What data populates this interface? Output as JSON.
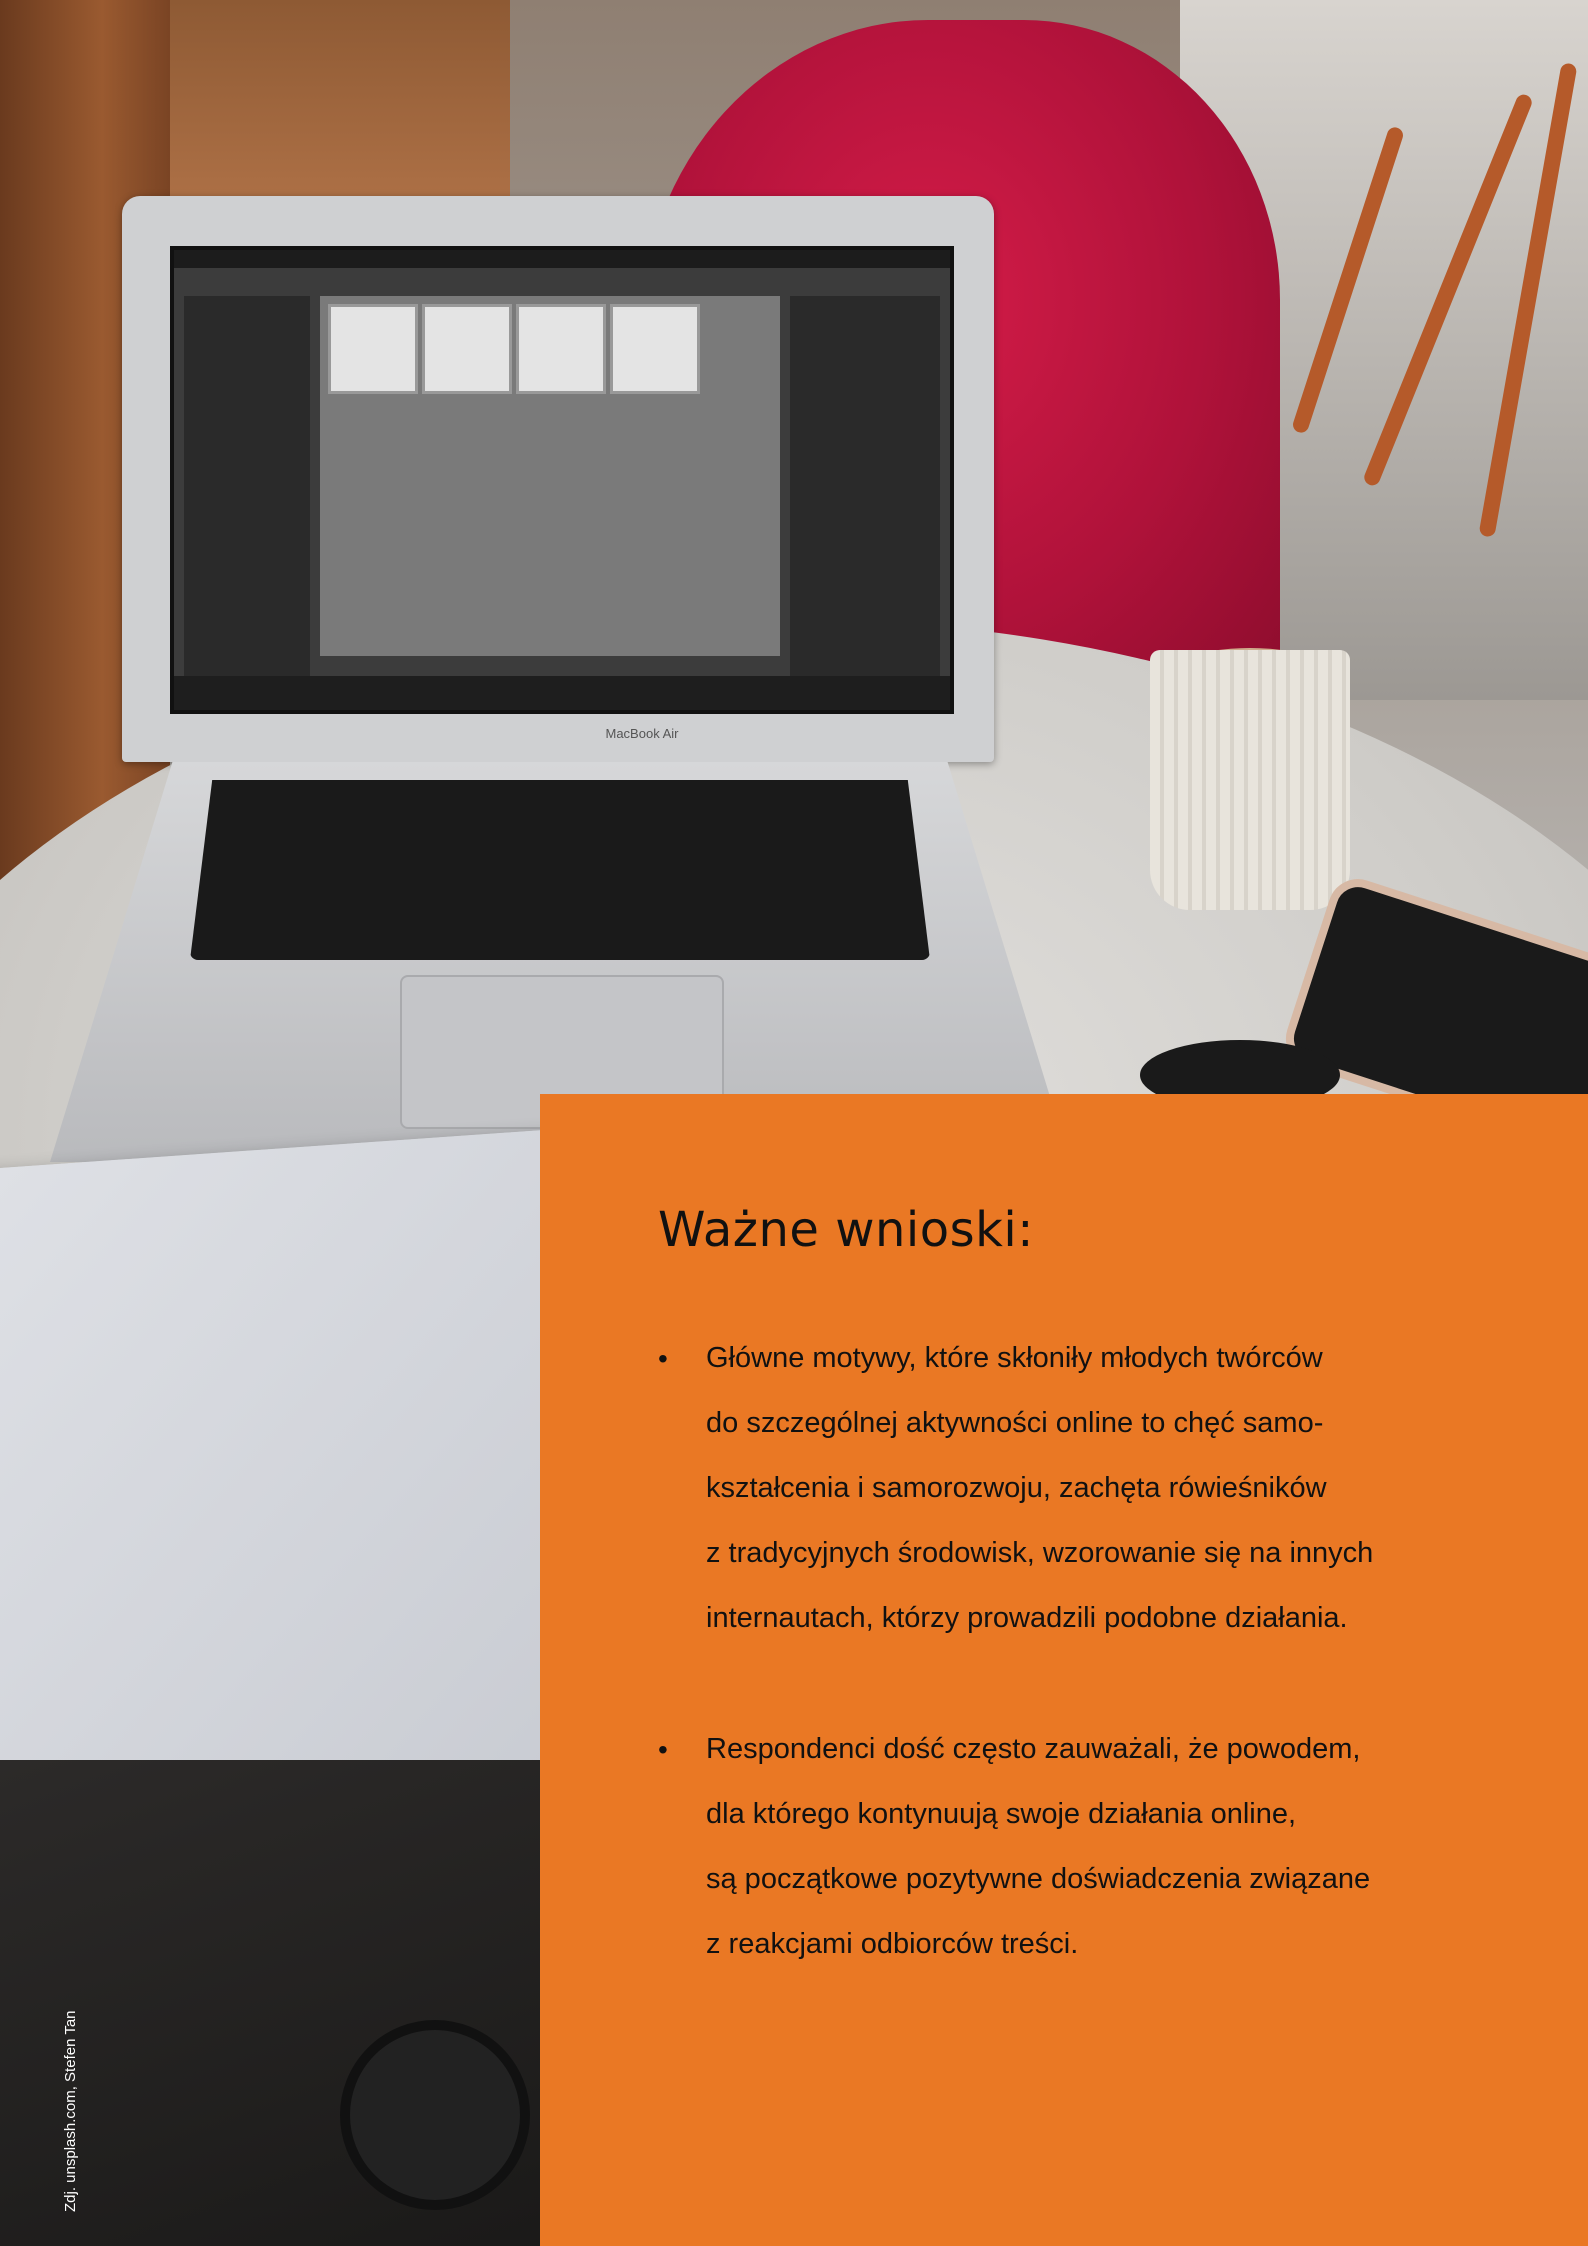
{
  "panel": {
    "title": "Ważne wnioski:",
    "bullets": [
      {
        "lines": [
          "Główne motywy, które skłoniły młodych twórców",
          "do szczególnej aktywności online to chęć samo-",
          "kształcenia i samorozwoju, zachęta rówieśników",
          "z tradycyjnych środowisk, wzorowanie się na innych",
          "internautach, którzy prowadzili podobne działania."
        ]
      },
      {
        "lines": [
          "Respondenci dość często zauważali, że powodem,",
          "dla którego kontynuują swoje działania online,",
          "są początkowe pozytywne doświadczenia związane",
          "z reakcjami odbiorców treści."
        ]
      }
    ]
  },
  "photo": {
    "laptop_model": "MacBook Air",
    "credit": "Zdj. unsplash.com, Stefen Tan"
  },
  "colors": {
    "panel_background": "#ea7824",
    "text": "#111111"
  }
}
